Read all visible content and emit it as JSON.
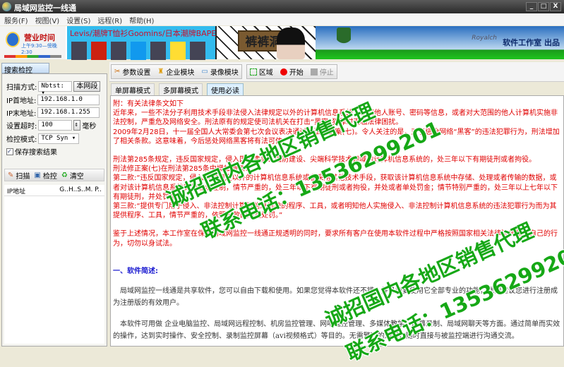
{
  "window": {
    "title": "局域网监控一线通",
    "controls": [
      "_",
      "□",
      "X"
    ]
  },
  "menu": [
    "服务(F)",
    "视图(V)",
    "设置(S)",
    "远程(R)",
    "帮助(H)"
  ],
  "banner": {
    "hours_title": "营业时间",
    "hours_text": "上午9:30—傍晚2:30",
    "shop_title": "Levis/潮牌T恤衫Goomins/日本潮牌BAPE",
    "shop_sign": "裤裤洞",
    "signature": "Royalch",
    "studio": "软件工作室 出品"
  },
  "left": {
    "tab": "搜索检控",
    "scan_mode_label": "扫描方式:",
    "scan_mode_value": "Nbtst:",
    "segment_btn": "本网段",
    "ip_start_label": "IP首地址:",
    "ip_start": "192.168.1.0",
    "ip_end_label": "IP末地址:",
    "ip_end": "192.168.1.255",
    "timeout_label": "设置超时:",
    "timeout": "100",
    "timeout_unit": "毫秒",
    "mode_label": "检控模式:",
    "mode_value": "TCP Syn",
    "save_label": "保存搜索结果",
    "save_checked": true,
    "actions": [
      "扫描",
      "检控",
      "清空"
    ],
    "columns": [
      "IP地址",
      "G..H..S..M. P.."
    ]
  },
  "toolbar": {
    "params": "参数设置",
    "enterprise": "企业模块",
    "record": "录像模块",
    "region": "区域",
    "start": "开始",
    "stop": "停止"
  },
  "tabs": [
    "单屏幕模式",
    "多屏幕模式",
    "使用必读"
  ],
  "content": {
    "red": [
      "附：有关法律条文如下",
      "近年来，一些不法分子利用技术手段非法侵入法律规定以外的计算机信息系统，窃取他人账号、密码等信息，或者对大范围的他人计算机实施非法控制，严重危及网络安全。刑法原有的规定使司法机关在打击“黑客”犯罪时面临法律困扰。",
      "2009年2月28日，十一届全国人大常委会第七次会议表决通过刑法修正案(七)。令人关注的是，对于惩治网络“黑客”的违法犯罪行为，刑法增加了相关条款。这意味着，今后惩处网络黑客将有法可依。",
      "",
      "刑法第285条规定，违反国家规定，侵入国家事务、国防建设、尖端科学技术领域的计算机信息系统的，处三年以下有期徒刑或者拘役。",
      "刑法修正案(七)在刑法第285条中增加两款：",
      "第二款:“违反国家规定，侵入前款规定以外的计算机信息系统或者采用其他技术手段，获取该计算机信息系统中存储、处理或者传输的数据，或者对该计算机信息系统实施非法控制，情节严重的，处三年以下有期徒刑或者拘役，并处或者单处罚金；情节特别严重的，处三年以上七年以下有期徒刑，并处罚金。”",
      "第三款:“提供专门用于侵入、非法控制计算机信息系统的程序、工具，或者明知他人实施侵入、非法控制计算机信息系统的违法犯罪行为而为其提供程序、工具，情节严重的，依照前款的规定处罚。”",
      "",
      "鉴于上述情况，本工作室在保证局域网监控一线通正规透明的同时，要求所有客户在使用本软件过程中严格按照国家相关法律法规规范自己的行为，切勿以身试法。"
    ],
    "heading": "一、软件简述:",
    "gray": [
      "　局域网监控一线通是共享软件，您可以自由下载和使用。如果您觉得本软件还不错，并且想要使用它全部专业的功能，我们建议您进行注册成为注册版的有效用户。",
      "　本软件可用做 企业电脑监控、局域网远程控制、机房监控管理、网吧监控管理、多媒体教学、屏幕录制、局域网聊天等方面。通过简单而实效的操作，达到实时操作、安全控制、录制监控屏幕（avi视频格式）等目的。无需繁冗的通知，随时直接与被监控端进行沟通交流。"
    ]
  },
  "watermark": {
    "line1": "诚招国内各地区销售代理",
    "line2": "联系电话：13536299201"
  }
}
